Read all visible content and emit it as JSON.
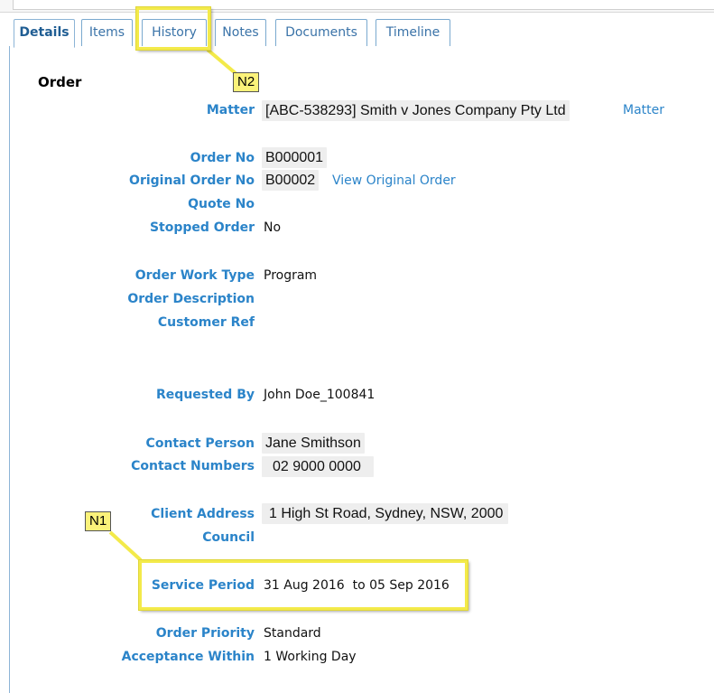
{
  "tabs": [
    {
      "label": "Details",
      "active": true
    },
    {
      "label": "Items",
      "active": false
    },
    {
      "label": "History",
      "active": false
    },
    {
      "label": "Notes",
      "active": false
    },
    {
      "label": "Documents",
      "active": false
    },
    {
      "label": "Timeline",
      "active": false
    }
  ],
  "section_title": "Order",
  "fields": {
    "matter": {
      "label": "Matter",
      "value": "[ABC-538293] Smith v Jones Company Pty Ltd",
      "link": "Matter"
    },
    "order_no": {
      "label": "Order No",
      "value": "B000001"
    },
    "original_order_no": {
      "label": "Original Order No",
      "value": "B00002",
      "link": "View Original Order"
    },
    "quote_no": {
      "label": "Quote No",
      "value": ""
    },
    "stopped_order": {
      "label": "Stopped Order",
      "value": "No"
    },
    "order_work_type": {
      "label": "Order Work Type",
      "value": "Program"
    },
    "order_description": {
      "label": "Order Description",
      "value": ""
    },
    "customer_ref": {
      "label": "Customer Ref",
      "value": ""
    },
    "requested_by": {
      "label": "Requested By",
      "value": "John Doe_100841"
    },
    "contact_person": {
      "label": "Contact Person",
      "value": "Jane Smithson"
    },
    "contact_numbers": {
      "label": "Contact Numbers",
      "value": "02 9000 0000"
    },
    "client_address": {
      "label": "Client Address",
      "value": "1 High St Road, Sydney, NSW, 2000"
    },
    "council": {
      "label": "Council",
      "value": ""
    },
    "service_period": {
      "label": "Service Period",
      "value": "31 Aug 2016  to 05 Sep 2016"
    },
    "order_priority": {
      "label": "Order Priority",
      "value": "Standard"
    },
    "acceptance_within": {
      "label": "Acceptance Within",
      "value": "1 Working Day"
    }
  },
  "annotations": {
    "n1": "N1",
    "n2": "N2"
  },
  "colors": {
    "label_blue": "#2b84c9",
    "tab_border": "#7aa9cf",
    "highlight_yellow": "#f3ea4a",
    "callout_fill": "#fbf27a"
  }
}
